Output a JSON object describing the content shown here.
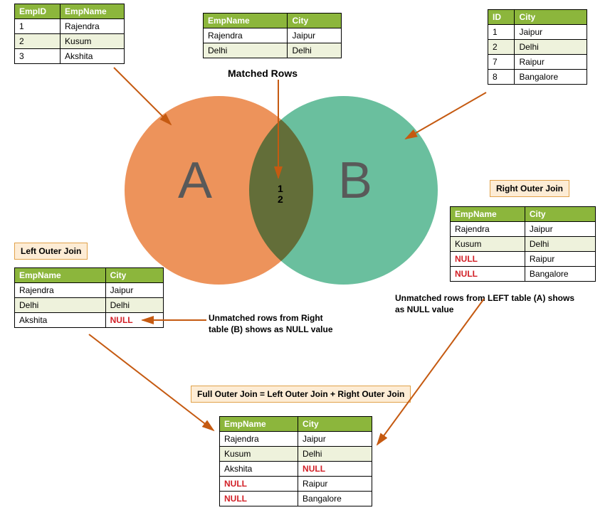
{
  "colors": {
    "header": "#8cb63c",
    "altRow": "#eef2dc",
    "null": "#d22027",
    "labelBox": "#fdecd5",
    "arrow": "#c55a11",
    "circleA": "#ed935b",
    "circleB": "#6abf9e"
  },
  "venn": {
    "letterA": "A",
    "letterB": "B",
    "intersect": [
      "1",
      "2"
    ]
  },
  "labels": {
    "matched": "Matched Rows",
    "leftJoin": "Left Outer Join",
    "rightJoin": "Right Outer Join",
    "fullJoin": "Full Outer Join = Left Outer Join + Right Outer Join",
    "noteLeft": "Unmatched rows from Right\ntable (B) shows as NULL value",
    "noteRight": "Unmatched rows from LEFT table (A) shows\nas NULL value"
  },
  "tables": {
    "emp": {
      "headers": [
        "EmpID",
        "EmpName"
      ],
      "rows": [
        [
          "1",
          "Rajendra"
        ],
        [
          "2",
          "Kusum"
        ],
        [
          "3",
          "Akshita"
        ]
      ]
    },
    "matched": {
      "headers": [
        "EmpName",
        "City"
      ],
      "rows": [
        [
          "Rajendra",
          "Jaipur"
        ],
        [
          "Delhi",
          "Delhi"
        ]
      ]
    },
    "city": {
      "headers": [
        "ID",
        "City"
      ],
      "rows": [
        [
          "1",
          "Jaipur"
        ],
        [
          "2",
          "Delhi"
        ],
        [
          "7",
          "Raipur"
        ],
        [
          "8",
          "Bangalore"
        ]
      ]
    },
    "left": {
      "headers": [
        "EmpName",
        "City"
      ],
      "rows": [
        [
          "Rajendra",
          "Jaipur"
        ],
        [
          "Delhi",
          "Delhi"
        ],
        [
          "Akshita",
          "NULL"
        ]
      ]
    },
    "right": {
      "headers": [
        "EmpName",
        "City"
      ],
      "rows": [
        [
          "Rajendra",
          "Jaipur"
        ],
        [
          "Kusum",
          "Delhi"
        ],
        [
          "NULL",
          "Raipur"
        ],
        [
          "NULL",
          "Bangalore"
        ]
      ]
    },
    "full": {
      "headers": [
        "EmpName",
        "City"
      ],
      "rows": [
        [
          "Rajendra",
          "Jaipur"
        ],
        [
          "Kusum",
          "Delhi"
        ],
        [
          "Akshita",
          "NULL"
        ],
        [
          "NULL",
          "Raipur"
        ],
        [
          "NULL",
          "Bangalore"
        ]
      ]
    }
  }
}
